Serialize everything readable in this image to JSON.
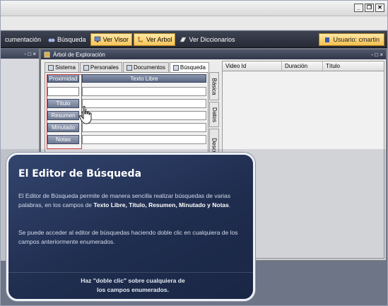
{
  "window": {
    "minimize_glyph": "_",
    "restore_glyph": "❐",
    "close_glyph": "✕"
  },
  "toolbar": {
    "items": [
      {
        "label": "cumentación",
        "icon": "document-icon",
        "highlight": false
      },
      {
        "label": "Búsqueda",
        "icon": "binoculars-icon",
        "highlight": false
      },
      {
        "label": "Ver Visor",
        "icon": "monitor-icon",
        "highlight": true
      },
      {
        "label": "Ver Arbol",
        "icon": "tree-icon",
        "highlight": true
      },
      {
        "label": "Ver Diccionarios",
        "icon": "dictionary-icon",
        "highlight": false
      }
    ],
    "user_label": "Usuario: cmartin"
  },
  "left_pane": {
    "controls": "- □ ×"
  },
  "explorer": {
    "title": "Árbol de Exploración",
    "controls": "- □ ×",
    "tabs": [
      {
        "label": "Sistema",
        "active": false
      },
      {
        "label": "Personales",
        "active": false
      },
      {
        "label": "Documentos",
        "active": false
      },
      {
        "label": "Búsqueda",
        "active": true
      }
    ],
    "headers": {
      "proximity": "Proximidad",
      "free_text": "Texto Libre"
    },
    "fields": [
      {
        "label": ""
      },
      {
        "label": "Título"
      },
      {
        "label": "Resumen"
      },
      {
        "label": "Minutado"
      },
      {
        "label": "Notas"
      }
    ],
    "vertical_tabs": [
      "Básica",
      "Datos",
      "Descriptor"
    ],
    "grid_columns": [
      "Video Id",
      "Duración",
      "Título"
    ]
  },
  "card": {
    "title": "El Editor de Búsqueda",
    "p1_pre": "El Editor de Búsqueda permite de manera sencilla realizar búsquedas de varias palabras, en los campos de ",
    "p1_bold": "Texto Libre, Título, Resumen, Minutado y Notas",
    "p1_post": ".",
    "p2": "Se puede acceder al editor de búsquedas haciendo doble clic en cualquiera de los campos anteriormente enumerados.",
    "footer_line1": "Haz \"doble clic\" sobre cualquiera de",
    "footer_line2": "los campos enumerados."
  },
  "colors": {
    "card_bg": "#1f2d4f",
    "toolbar_bg": "#2b3040",
    "highlight": "#f7c55a",
    "annotation_red": "#cc3a3a"
  }
}
